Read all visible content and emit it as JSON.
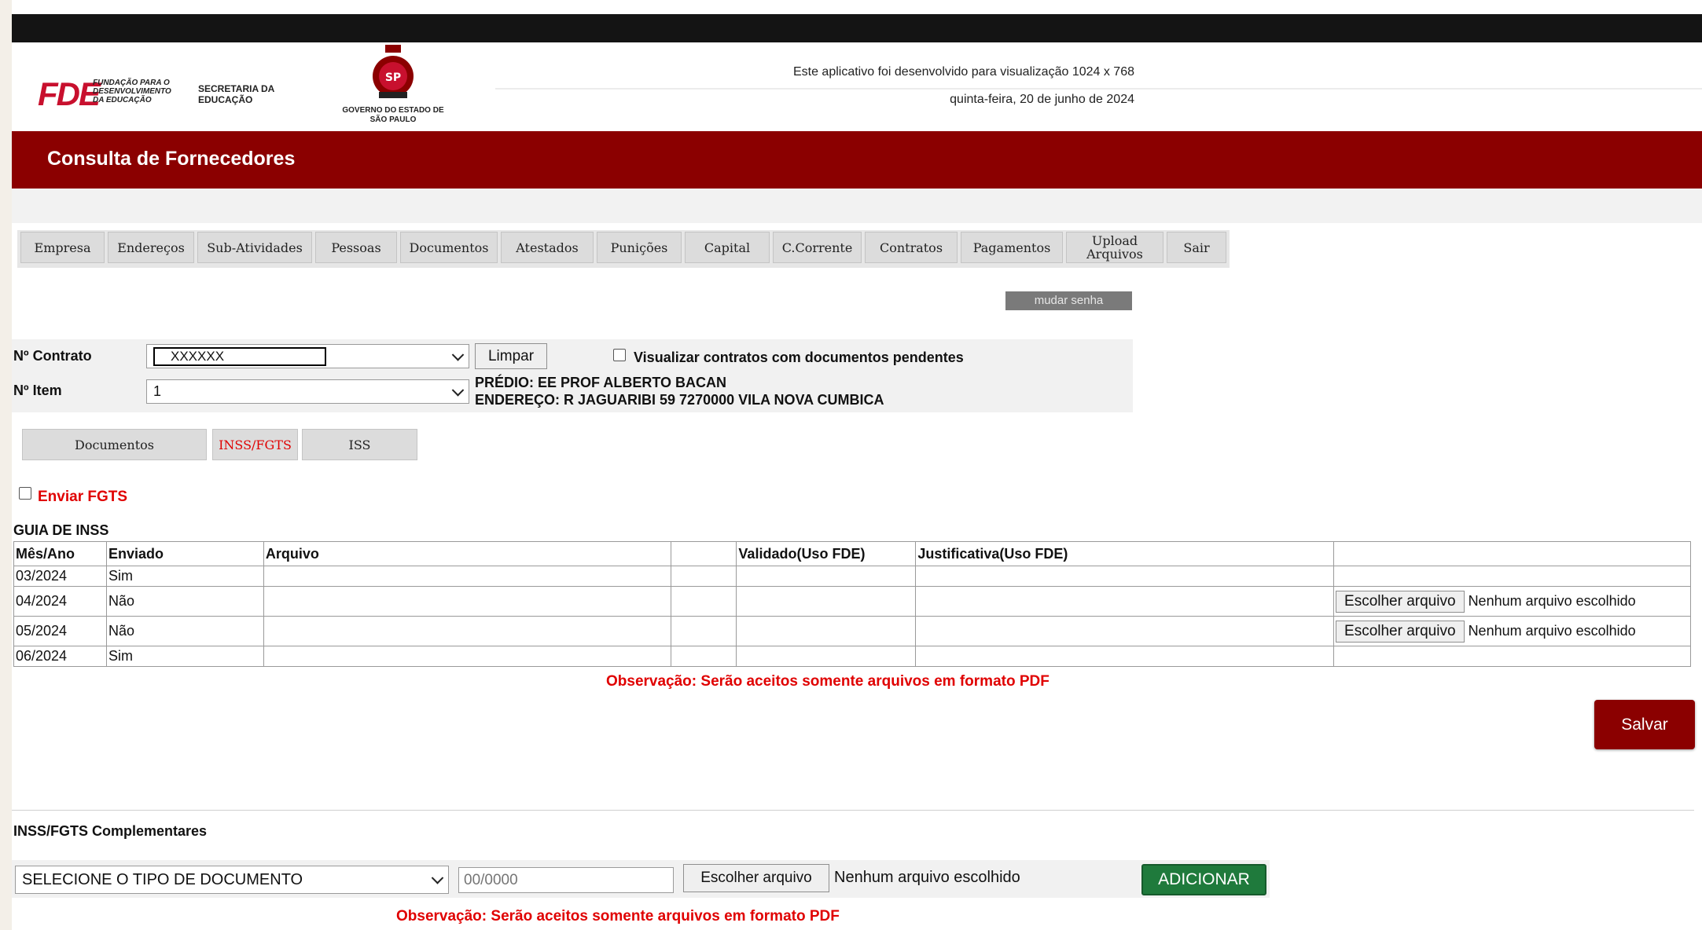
{
  "header": {
    "logo_text": "FDE",
    "logo_sub": "FUNDAÇÃO PARA O DESENVOLVIMENTO DA EDUCAÇÃO",
    "secretaria": "SECRETARIA DA EDUCAÇÃO",
    "governo": "GOVERNO DO ESTADO DE SÃO PAULO",
    "info_resolution": "Este aplicativo foi desenvolvido para visualização 1024 x 768",
    "info_date": "quinta-feira, 20 de junho de 2024",
    "banner_title": "Consulta de Fornecedores"
  },
  "nav_tabs": [
    {
      "label": "Empresa"
    },
    {
      "label": "Endereços"
    },
    {
      "label": "Sub-Atividades"
    },
    {
      "label": "Pessoas"
    },
    {
      "label": "Documentos"
    },
    {
      "label": "Atestados"
    },
    {
      "label": "Punições"
    },
    {
      "label": "Capital"
    },
    {
      "label": "C.Corrente"
    },
    {
      "label": "Contratos"
    },
    {
      "label": "Pagamentos"
    },
    {
      "label": "Upload Arquivos"
    },
    {
      "label": "Sair"
    }
  ],
  "mudar_senha": "mudar senha",
  "form": {
    "contrato_label": "Nº Contrato",
    "contrato_value": "XXXXXX",
    "limpar": "Limpar",
    "pendentes_label": "Visualizar contratos com documentos pendentes",
    "item_label": "Nº Item",
    "item_value": "1",
    "predio": "PRÉDIO: EE PROF ALBERTO BACAN",
    "endereco": "ENDEREÇO: R JAGUARIBI 59 7270000 VILA NOVA CUMBICA"
  },
  "sub_tabs": [
    {
      "label": "Documentos",
      "active": false
    },
    {
      "label": "INSS/FGTS",
      "active": true
    },
    {
      "label": "ISS",
      "active": false
    }
  ],
  "enviar_fgts": "Enviar FGTS",
  "guia": {
    "title": "GUIA DE INSS",
    "headers": [
      "Mês/Ano",
      "Enviado",
      "Arquivo",
      "",
      "Validado(Uso FDE)",
      "Justificativa(Uso FDE)",
      ""
    ],
    "rows": [
      {
        "mes": "03/2024",
        "enviado": "Sim"
      },
      {
        "mes": "04/2024",
        "enviado": "Não"
      },
      {
        "mes": "05/2024",
        "enviado": "Não"
      },
      {
        "mes": "06/2024",
        "enviado": "Sim"
      }
    ],
    "file_button": "Escolher arquivo",
    "no_file": "Nenhum arquivo escolhido",
    "observacao": "Observação: Serão aceitos somente arquivos em formato PDF"
  },
  "salvar": "Salvar",
  "complementares": {
    "title": "INSS/FGTS Complementares",
    "tipo_select": "SELECIONE O TIPO DE DOCUMENTO",
    "date_placeholder": "00/0000",
    "file_button": "Escolher arquivo",
    "no_file": "Nenhum arquivo escolhido",
    "adicionar": "ADICIONAR",
    "observacao": "Observação: Serão aceitos somente arquivos em formato PDF"
  },
  "colors": {
    "banner": "#8b0000",
    "accent_red": "#e00000",
    "add_green": "#1f7a3c"
  }
}
